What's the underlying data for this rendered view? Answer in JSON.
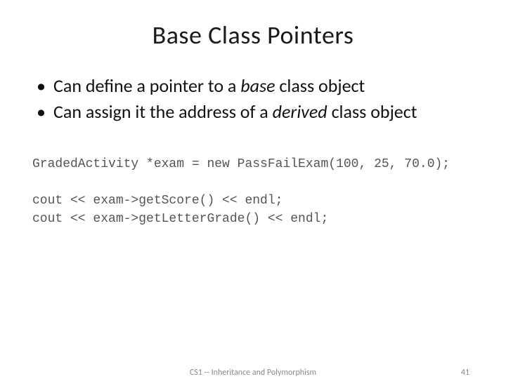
{
  "title": "Base Class Pointers",
  "bullets": [
    {
      "pre": "Can define a pointer to a ",
      "em": "base",
      "post": " class object"
    },
    {
      "pre": "Can assign it the address of a ",
      "em": "derived",
      "post": " class object"
    }
  ],
  "code": {
    "line1": "GradedActivity *exam = new PassFailExam(100, 25, 70.0);",
    "line2": "cout << exam->getScore() << endl;",
    "line3": "cout << exam->getLetterGrade() << endl;"
  },
  "footer": {
    "center": "CS1 -- Inheritance and Polymorphism",
    "pageNumber": "41"
  }
}
